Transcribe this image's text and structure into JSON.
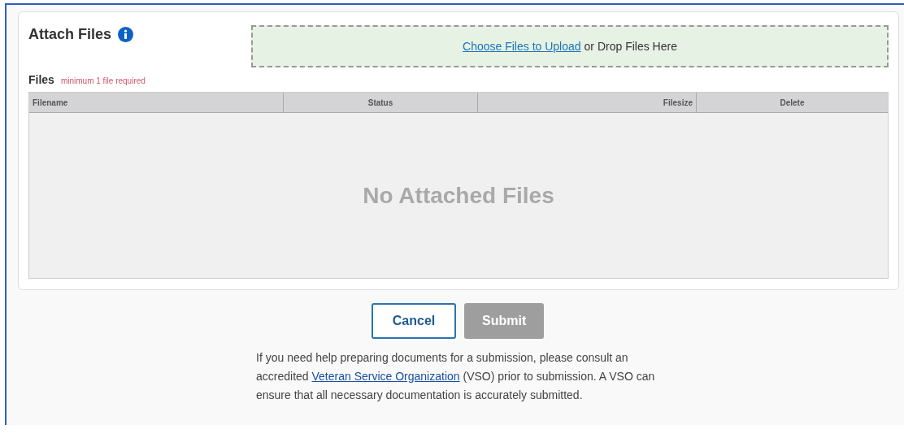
{
  "attach": {
    "title": "Attach Files"
  },
  "dropzone": {
    "link": "Choose Files to Upload",
    "text": "or Drop Files Here"
  },
  "files": {
    "label": "Files",
    "hint": "minimum 1 file required"
  },
  "table": {
    "columns": [
      "Filename",
      "Status",
      "Filesize",
      "Delete"
    ],
    "empty_message": "No Attached Files"
  },
  "buttons": [
    {
      "label": "Cancel",
      "disabled": false
    },
    {
      "label": "Submit",
      "disabled": true
    }
  ],
  "help": {
    "before": "If you need help preparing documents for a submission, please consult an accredited",
    "link": "Veteran Service Organization",
    "after": "(VSO) prior to submission. A VSO can ensure that all necessary documentation is accurately submitted."
  }
}
